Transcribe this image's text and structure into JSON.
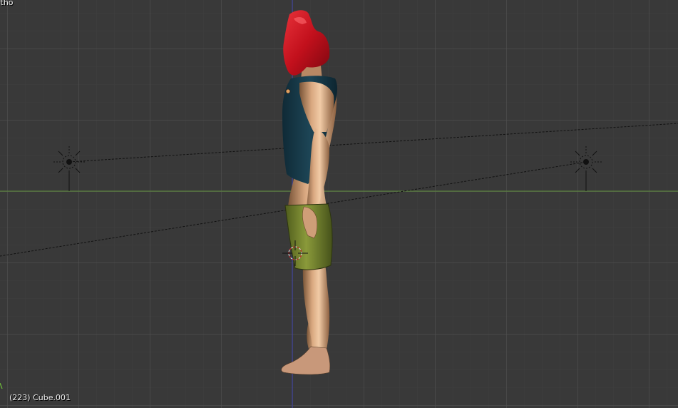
{
  "viewport": {
    "view_label": "rtho",
    "object_info": "(223) Cube.001"
  },
  "colors": {
    "background": "#393939",
    "grid_minor": "#3e3e3e",
    "grid_major": "#525252",
    "x_axis": "#5e8e3a",
    "z_axis": "#3a3ea8",
    "hair": "#c8121f",
    "top": "#173847",
    "shorts": "#6d7c2b",
    "skin": "#c99b73"
  },
  "icons": {
    "lamp_left": "lamp-icon",
    "lamp_right": "lamp-icon",
    "cursor": "3d-cursor-icon",
    "origin": "object-origin-icon"
  }
}
